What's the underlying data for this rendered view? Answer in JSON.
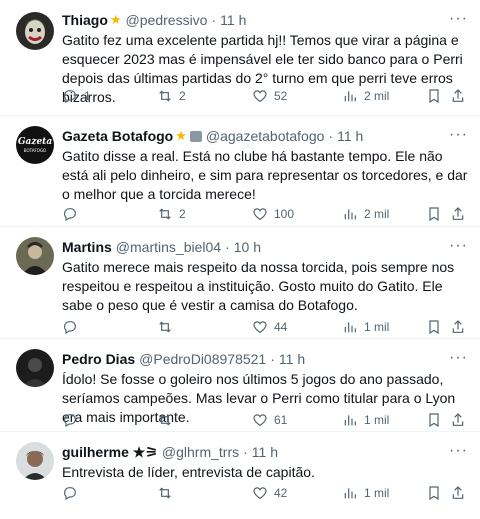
{
  "tweets": [
    {
      "name": "Thiago",
      "badge": "star",
      "handle": "@pedressivo",
      "time": "11 h",
      "text": "Gatito fez uma excelente partida hj!! Temos que virar a página e esquecer 2023 mas é impensável ele ter sido banco para o Perri depois das últimas partidas do 2° turno em que perri teve erros bizarros.",
      "replies": "1",
      "retweets": "2",
      "likes": "52",
      "views": "2 mil"
    },
    {
      "name": "Gazeta Botafogo",
      "badge": "star-news",
      "handle": "@agazetabotafogo",
      "time": "11 h",
      "text": "Gatito disse a real. Está no clube há bastante tempo. Ele não está ali pelo dinheiro, e sim para representar os torcedores, e dar o melhor que a torcida merece!",
      "replies": "",
      "retweets": "2",
      "likes": "100",
      "views": "2 mil"
    },
    {
      "name": "Martins",
      "badge": "",
      "handle": "@martins_biel04",
      "time": "10 h",
      "text": "Gatito merece mais respeito da nossa torcida, pois sempre nos respeitou e respeitou a instituição. Gosto muito do Gatito. Ele sabe o peso que é vestir a camisa do Botafogo.",
      "replies": "",
      "retweets": "",
      "likes": "44",
      "views": "1 mil"
    },
    {
      "name": "Pedro Dias",
      "badge": "",
      "handle": "@PedroDi08978521",
      "time": "11 h",
      "text": "Ídolo! Se fosse o goleiro nos últimos 5 jogos do ano passado, seríamos campeões. Mas levar o Perri como titular para o Lyon era mais importante.",
      "replies": "",
      "retweets": "",
      "likes": "61",
      "views": "1 mil"
    },
    {
      "name": "guilherme ★⚞",
      "badge": "",
      "handle": "@glhrm_trrs",
      "time": "11 h",
      "text": "Entrevista de líder, entrevista de capitão.",
      "replies": "",
      "retweets": "",
      "likes": "42",
      "views": "1 mil"
    }
  ],
  "colors": {
    "text": "#0f1419",
    "muted": "#536471",
    "divider": "#eff3f4",
    "star": "#f5b800"
  },
  "avatar_lettering": {
    "gazeta": "GAZETA BOTAFOGO"
  }
}
